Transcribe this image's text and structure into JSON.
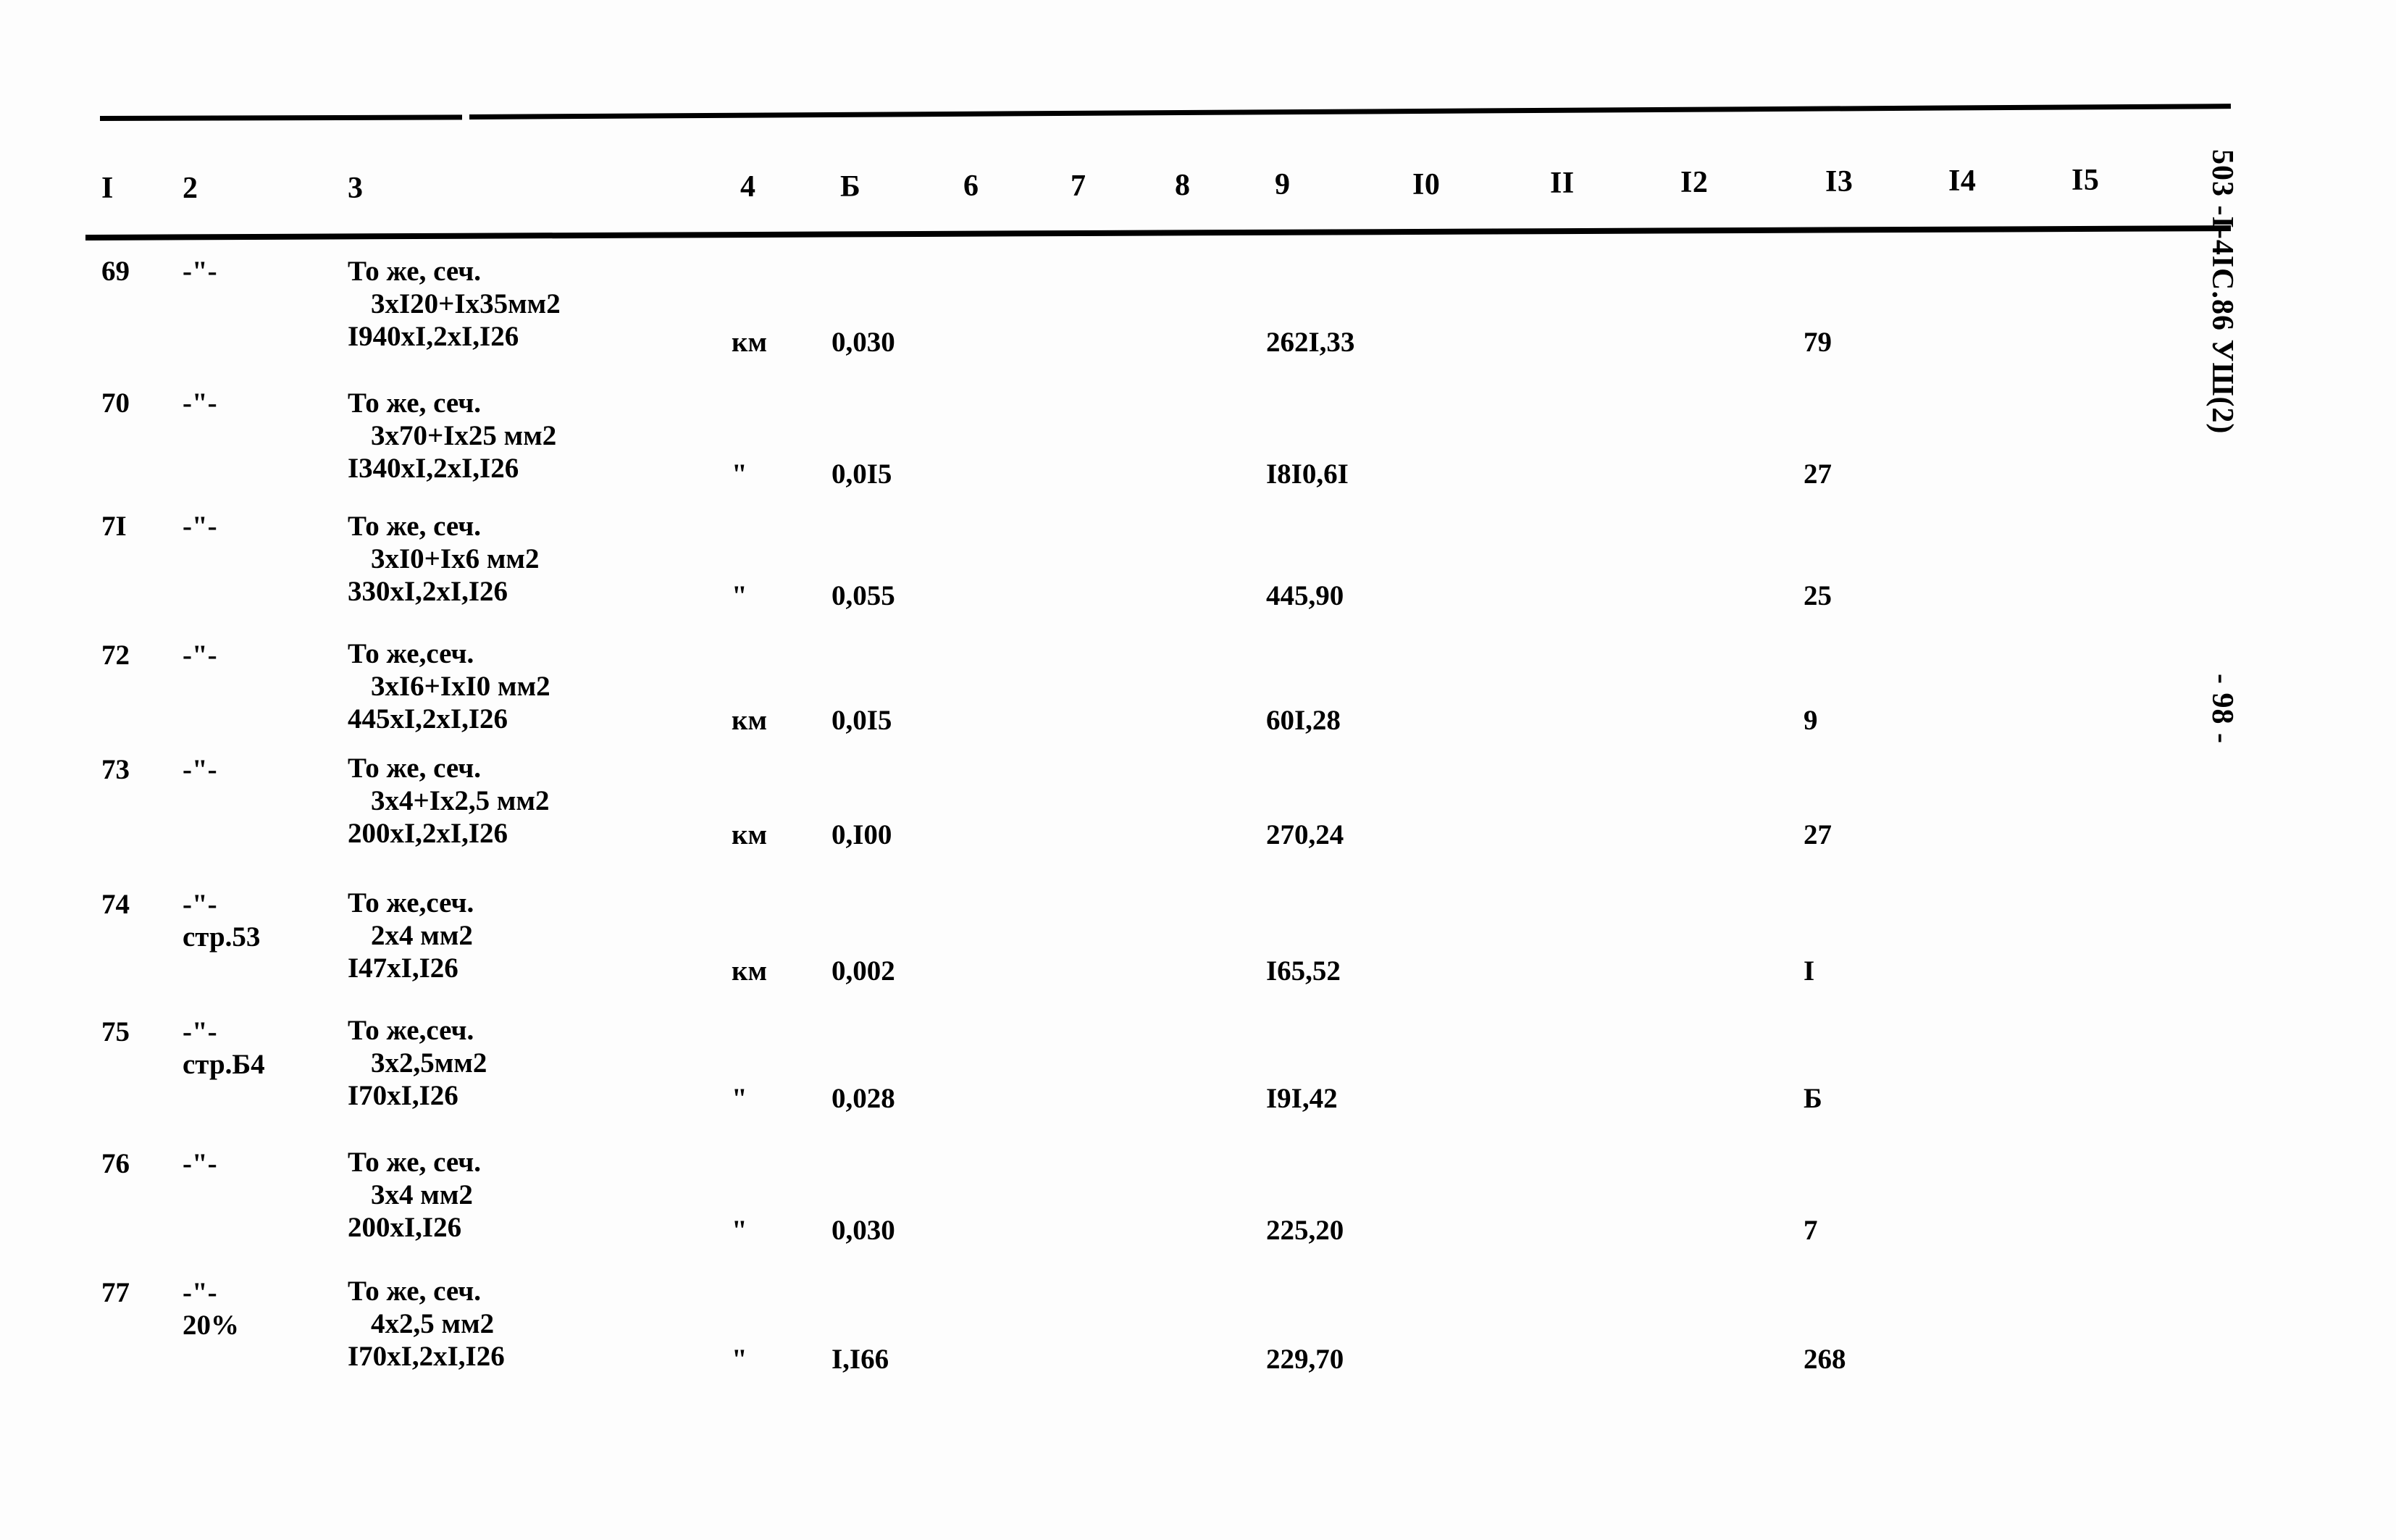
{
  "document": {
    "margin_code": "503 -I-4IC.86 УШ(2)",
    "page_marker": "- 98 -"
  },
  "table": {
    "columns": [
      "I",
      "2",
      "3",
      "4",
      "Б",
      "6",
      "7",
      "8",
      "9",
      "I0",
      "II",
      "I2",
      "I3",
      "I4",
      "I5"
    ],
    "rows": [
      {
        "no": "69",
        "ref": "-\"-",
        "ref_sub": "",
        "desc_l1": "То же, сеч.",
        "desc_l2": "3xI20+Ix35мм2",
        "desc_l3": "I940xI,2xI,I26",
        "unit": "км",
        "qty": "0,030",
        "price": "262I,33",
        "total": "79"
      },
      {
        "no": "70",
        "ref": "-\"-",
        "ref_sub": "",
        "desc_l1": "То же, сеч.",
        "desc_l2": "3x70+Ix25 мм2",
        "desc_l3": "I340xI,2xI,I26",
        "unit": "\"",
        "qty": "0,0I5",
        "price": "I8I0,6I",
        "total": "27"
      },
      {
        "no": "7I",
        "ref": "-\"-",
        "ref_sub": "",
        "desc_l1": "То же, сеч.",
        "desc_l2": "3xI0+Ix6 мм2",
        "desc_l3": "330xI,2xI,I26",
        "unit": "\"",
        "qty": "0,055",
        "price": "445,90",
        "total": "25"
      },
      {
        "no": "72",
        "ref": "-\"-",
        "ref_sub": "",
        "desc_l1": "То же,сеч.",
        "desc_l2": "3xI6+IxI0 мм2",
        "desc_l3": "445xI,2xI,I26",
        "unit": "км",
        "qty": "0,0I5",
        "price": "60I,28",
        "total": "9"
      },
      {
        "no": "73",
        "ref": "-\"-",
        "ref_sub": "",
        "desc_l1": "То же, сеч.",
        "desc_l2": "3x4+Ix2,5 мм2",
        "desc_l3": "200xI,2xI,I26",
        "unit": "км",
        "qty": "0,I00",
        "price": "270,24",
        "total": "27"
      },
      {
        "no": "74",
        "ref": "-\"-",
        "ref_sub": "стр.53",
        "desc_l1": "То же,сеч.",
        "desc_l2": "2x4 мм2",
        "desc_l3": "I47xI,I26",
        "unit": "км",
        "qty": "0,002",
        "price": "I65,52",
        "total": "I"
      },
      {
        "no": "75",
        "ref": "-\"-",
        "ref_sub": "стр.Б4",
        "desc_l1": "То же,сеч.",
        "desc_l2": "3x2,5мм2",
        "desc_l3": "I70xI,I26",
        "unit": "\"",
        "qty": "0,028",
        "price": "I9I,42",
        "total": "Б"
      },
      {
        "no": "76",
        "ref": "-\"-",
        "ref_sub": "",
        "desc_l1": "То же, сеч.",
        "desc_l2": "3x4 мм2",
        "desc_l3": "200xI,I26",
        "unit": "\"",
        "qty": "0,030",
        "price": "225,20",
        "total": "7"
      },
      {
        "no": "77",
        "ref": "-\"-",
        "ref_sub": "20%",
        "desc_l1": "То же, сеч.",
        "desc_l2": "4x2,5 мм2",
        "desc_l3": "I70xI,2xI,I26",
        "unit": "\"",
        "qty": "I,I66",
        "price": "229,70",
        "total": "268"
      }
    ]
  }
}
